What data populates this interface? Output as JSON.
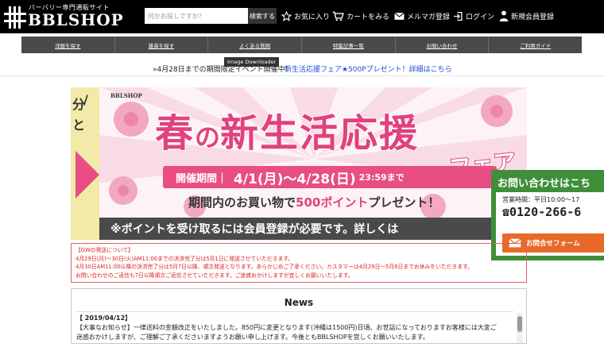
{
  "header": {
    "logo_sub": "バーバリー専門通販サイト",
    "logo_main": "BBLSHOP",
    "search_placeholder": "何かお探しですか？",
    "search_button": "検索する",
    "favorites": "お気に入り",
    "cart": "カートをみる",
    "newsletter": "メルマガ登録",
    "login": "ログイン",
    "register": "新規会員登録"
  },
  "category_nav": [
    "洋服を探す",
    "雑貨を探す",
    "よくある質問",
    "特集記事一覧",
    "お問い合わせ",
    "ご利用ガイド"
  ],
  "notice": {
    "prefix": "»4月28日までの期間限定イベント開催中！",
    "link": "新生活応援フェア★500Pプレゼント！詳細はこちら"
  },
  "tooltip": "Image Downloader",
  "banner": {
    "left_text": [
      "分",
      "/",
      "と"
    ],
    "logo": "BBLSHOP",
    "title_a": "春",
    "title_b": "の",
    "title_c": "新生活応援",
    "title_sub": "フェア",
    "period_label": "開催期間｜",
    "period_range": "4/1(月)〜4/28(日)",
    "period_time": "23:59まで",
    "offer_a": "期間内のお買い物で",
    "offer_b": "500ポイント",
    "offer_c": "プレゼント！",
    "bottom": "※ポイントを受け取るには会員登録が必要です。詳しくは"
  },
  "contact": {
    "title": "お問い合わせはこち",
    "hours": "営業時間：平日10:00〜17",
    "phone": "0120-266-6",
    "button": "お問合せフォーム"
  },
  "gw_notice": {
    "lines": [
      "【GWの発送について】",
      "4月29日(月)〜30日(火)AM11:00までの決済完了分は5月1日に発送させていただきます。",
      "4月30日AM11:00以降の決済完了分は5月7日以降、順次発送となります。あらかじめご了承ください。カスタマーは4月29日〜5月6日までお休みをいただきます。",
      "お問い合わせのご返信も7日以降順次ご返信させていただきます。ご迷惑おかけしますが宜しくお願いいたします。"
    ]
  },
  "news": {
    "title": "News",
    "date": "【 2019/04/12】",
    "line1": "【大事なお知らせ】一律送料の金額改正をいたしました。850円に変更となります(沖縄は1500円)日頃、お世話になっておりますお客様には大変ご",
    "line2": "迷惑おかけしますが、ご理解ご了承くださいますようお願い申し上げます。今後ともBBLSHOPを宜しくお願いいたします。"
  },
  "colors": {
    "header_bg": "#000000",
    "nav_bg": "#4a4a4a",
    "link_blue": "#1a4fd6",
    "banner_pink": "#e0427d",
    "contact_green": "#3f8f3a",
    "contact_orange": "#e8692a",
    "notice_red": "#dd2222"
  }
}
